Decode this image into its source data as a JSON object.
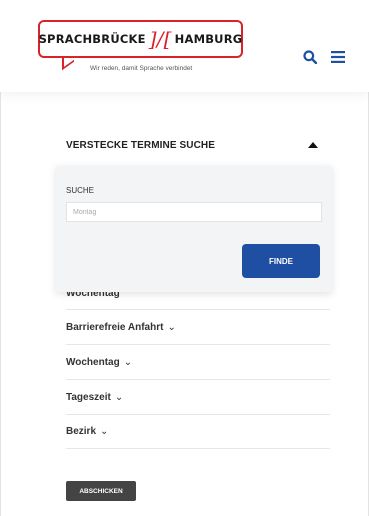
{
  "header": {
    "logo_left": "SPRACHBRÜCKE",
    "logo_sep": "]/[",
    "logo_right": "HAMBURG",
    "logo_tagline": "Wir reden, damit Sprache verbindet"
  },
  "icons": {
    "search": "search-icon",
    "menu": "hamburger-menu-icon",
    "collapse": "caret-up-icon"
  },
  "colors": {
    "brand_red": "#d8232a",
    "accent_blue": "#1f4fa3",
    "submit_gray": "#444444"
  },
  "search_panel": {
    "title": "VERSTECKE TERMINE SUCHE",
    "search_label": "SUCHE",
    "input_placeholder": "Montag",
    "finde_label": "FINDE",
    "occluded_label": "Wochentag"
  },
  "filters": [
    {
      "label": "Barrierefreie Anfahrt",
      "chevron": "⌄"
    },
    {
      "label": "Wochentag",
      "chevron": "⌄"
    },
    {
      "label": "Tageszeit",
      "chevron": "⌄"
    },
    {
      "label": "Bezirk",
      "chevron": "⌄"
    }
  ],
  "submit_label": "ABSCHICKEN"
}
